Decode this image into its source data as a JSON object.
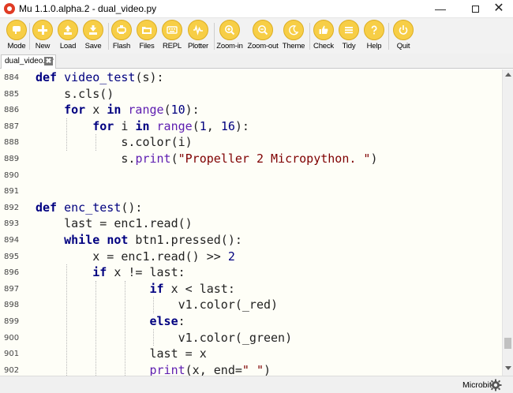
{
  "window": {
    "title": "Mu 1.1.0.alpha.2 - dual_video.py",
    "minimize": "—",
    "close": "✕"
  },
  "toolbar": {
    "buttons": [
      {
        "label": "Mode",
        "icon": "mode-icon"
      },
      {
        "label": "New",
        "icon": "plus-icon"
      },
      {
        "label": "Load",
        "icon": "load-icon"
      },
      {
        "label": "Save",
        "icon": "save-icon"
      },
      {
        "label": "Flash",
        "icon": "flash-icon"
      },
      {
        "label": "Files",
        "icon": "files-icon"
      },
      {
        "label": "REPL",
        "icon": "keyboard-icon"
      },
      {
        "label": "Plotter",
        "icon": "plotter-icon"
      },
      {
        "label": "Zoom-in",
        "icon": "zoom-in-icon"
      },
      {
        "label": "Zoom-out",
        "icon": "zoom-out-icon"
      },
      {
        "label": "Theme",
        "icon": "moon-icon"
      },
      {
        "label": "Check",
        "icon": "thumbs-up-icon"
      },
      {
        "label": "Tidy",
        "icon": "tidy-icon"
      },
      {
        "label": "Help",
        "icon": "help-icon"
      },
      {
        "label": "Quit",
        "icon": "power-icon"
      }
    ],
    "accent_color": "#f7ce46"
  },
  "tabs": [
    {
      "label": "dual_video.py",
      "close": "✖"
    }
  ],
  "editor": {
    "lines": [
      {
        "num": "884",
        "text": "def video_test(s):"
      },
      {
        "num": "885",
        "text": "    s.cls()"
      },
      {
        "num": "886",
        "text": "    for x in range(10):"
      },
      {
        "num": "887",
        "text": "        for i in range(1, 16):"
      },
      {
        "num": "888",
        "text": "            s.color(i)"
      },
      {
        "num": "889",
        "text": "            s.print(\"Propeller 2 Micropython. \")"
      },
      {
        "num": "890",
        "text": ""
      },
      {
        "num": "891",
        "text": ""
      },
      {
        "num": "892",
        "text": "def enc_test():"
      },
      {
        "num": "893",
        "text": "    last = enc1.read()"
      },
      {
        "num": "894",
        "text": "    while not btn1.pressed():"
      },
      {
        "num": "895",
        "text": "        x = enc1.read() >> 2"
      },
      {
        "num": "896",
        "text": "        if x != last:"
      },
      {
        "num": "897",
        "text": "                if x < last:"
      },
      {
        "num": "898",
        "text": "                    v1.color(_red)"
      },
      {
        "num": "899",
        "text": "                else:"
      },
      {
        "num": "900",
        "text": "                    v1.color(_green)"
      },
      {
        "num": "901",
        "text": "                last = x"
      },
      {
        "num": "902",
        "text": "                print(x, end=\" \")"
      }
    ]
  },
  "statusbar": {
    "mode": "Microbit"
  }
}
